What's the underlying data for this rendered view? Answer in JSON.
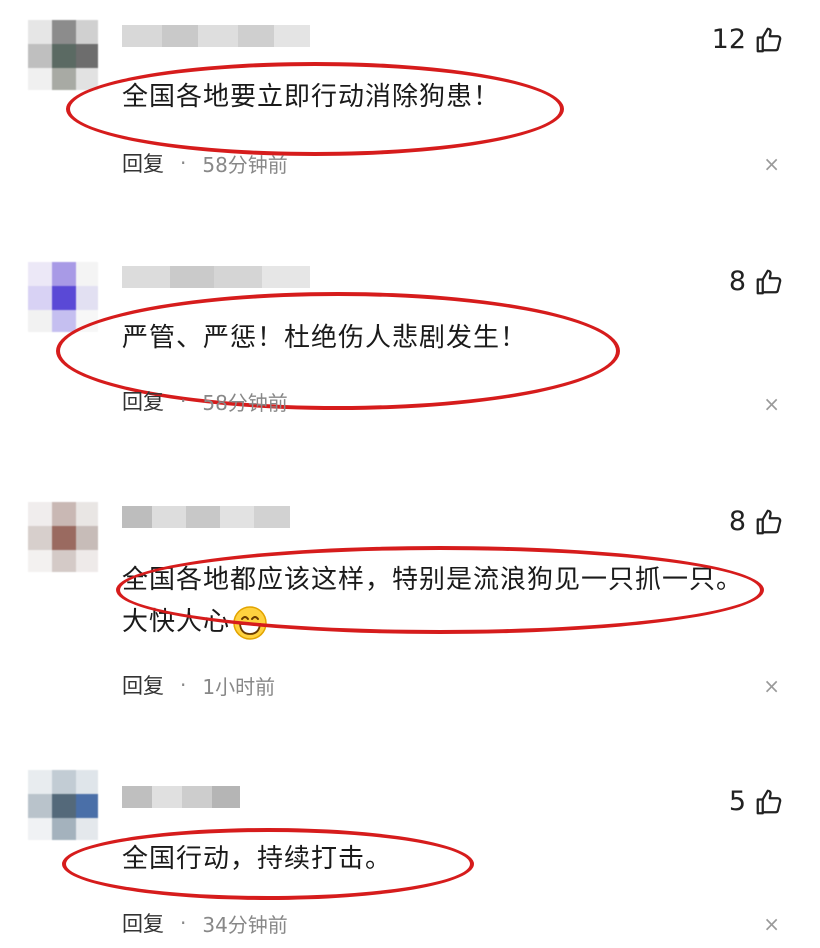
{
  "colors": {
    "annotation": "#d61c1c",
    "text": "#1a1a1a",
    "muted": "#888888"
  },
  "comments": [
    {
      "likes": "12",
      "text": "全国各地要立即行动消除狗患！",
      "text2": "",
      "reply": "回复",
      "sep": "·",
      "time": "58分钟前",
      "close": "×"
    },
    {
      "likes": "8",
      "text": "严管、严惩！杜绝伤人悲剧发生！",
      "text2": "",
      "reply": "回复",
      "sep": "·",
      "time": "58分钟前",
      "close": "×"
    },
    {
      "likes": "8",
      "text": "全国各地都应该这样，特别是流浪狗见一只抓一只。",
      "text2": "大快人心",
      "emoji": "grinning-face-icon",
      "reply": "回复",
      "sep": "·",
      "time": "1小时前",
      "close": "×"
    },
    {
      "likes": "5",
      "text": "全国行动，持续打击。",
      "text2": "",
      "reply": "回复",
      "sep": "·",
      "time": "34分钟前",
      "close": "×"
    }
  ]
}
